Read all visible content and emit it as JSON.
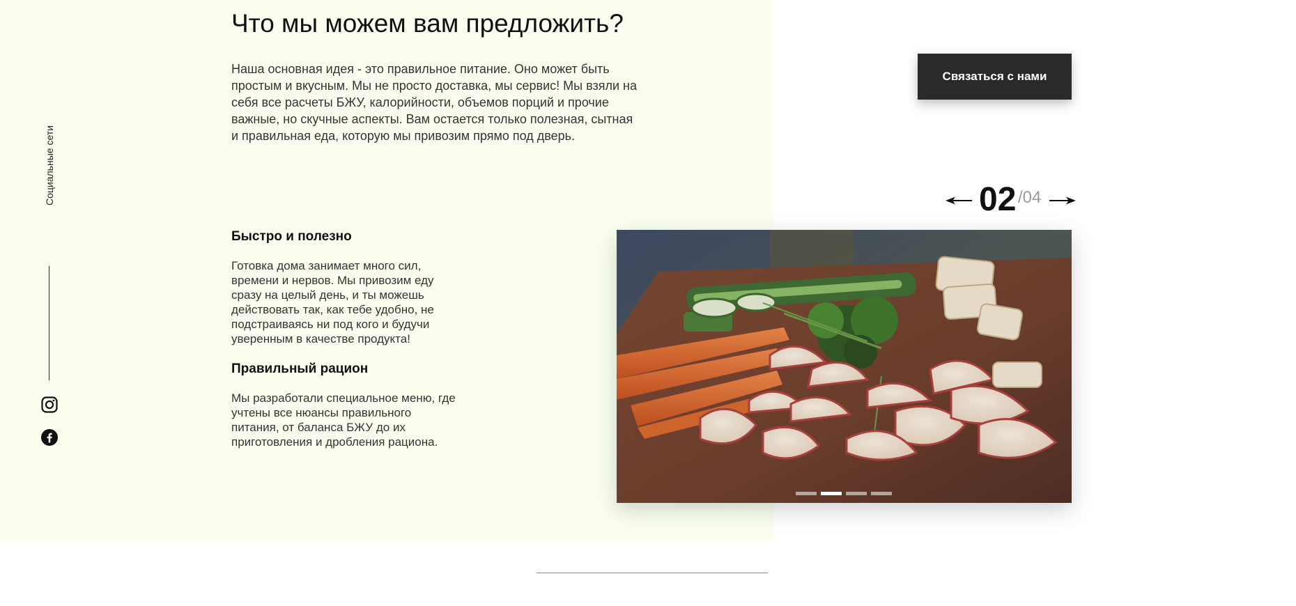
{
  "social": {
    "label": "Социальные сети",
    "icons": [
      "instagram-icon",
      "facebook-icon"
    ]
  },
  "offer": {
    "title": "Что мы можем вам предложить?",
    "intro": "Наша основная идея - это правильное питание. Оно может быть простым и вкусным. Мы не просто доставка, мы сервис! Мы взяли на себя все расчеты БЖУ, калорийности, объемов порций и прочие важные, но скучные аспекты. Вам остается только полезная, сытная и правильная еда, которую мы привозим прямо под дверь."
  },
  "features": [
    {
      "title": "Быстро и полезно",
      "text": "Готовка дома занимает много сил, времени и нервов. Мы привозим еду сразу на целый день, и ты можешь действовать так, как тебе удобно, не подстраиваясь ни под кого и будучи уверенным в качестве продукта!"
    },
    {
      "title": "Правильный рацион",
      "text": "Мы разработали специальное меню, где учтены все нюансы правильного питания, от баланса БЖУ до их приготовления и дробления рациона."
    }
  ],
  "cta": {
    "label": "Связаться с нами"
  },
  "slider": {
    "current": "02",
    "total": "/04",
    "active_index": 2,
    "count": 4
  },
  "colors": {
    "panel_bg": "#fafff0",
    "button_bg": "#2a2a2a",
    "text": "#333333"
  }
}
